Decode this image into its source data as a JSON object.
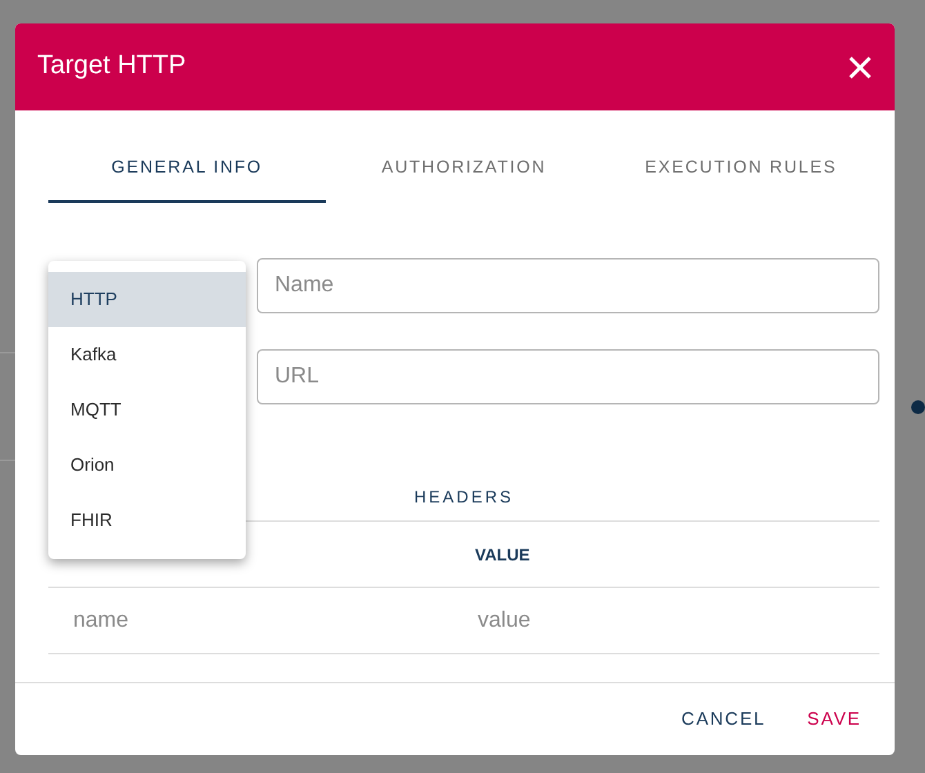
{
  "dialog": {
    "title": "Target HTTP"
  },
  "tabs": [
    {
      "label": "GENERAL INFO",
      "selected": true
    },
    {
      "label": "AUTHORIZATION",
      "selected": false
    },
    {
      "label": "EXECUTION RULES",
      "selected": false
    }
  ],
  "form": {
    "name_placeholder": "Name",
    "url_placeholder": "URL"
  },
  "type_menu": [
    {
      "label": "HTTP",
      "selected": true
    },
    {
      "label": "Kafka",
      "selected": false
    },
    {
      "label": "MQTT",
      "selected": false
    },
    {
      "label": "Orion",
      "selected": false
    },
    {
      "label": "FHIR",
      "selected": false
    }
  ],
  "headers": {
    "title": "HEADERS",
    "column_2": "VALUE",
    "name_placeholder": "name",
    "value_placeholder": "value"
  },
  "footer_buttons": [
    {
      "label": "CANCEL",
      "kind": "secondary"
    },
    {
      "label": "SAVE",
      "kind": "primary"
    }
  ]
}
